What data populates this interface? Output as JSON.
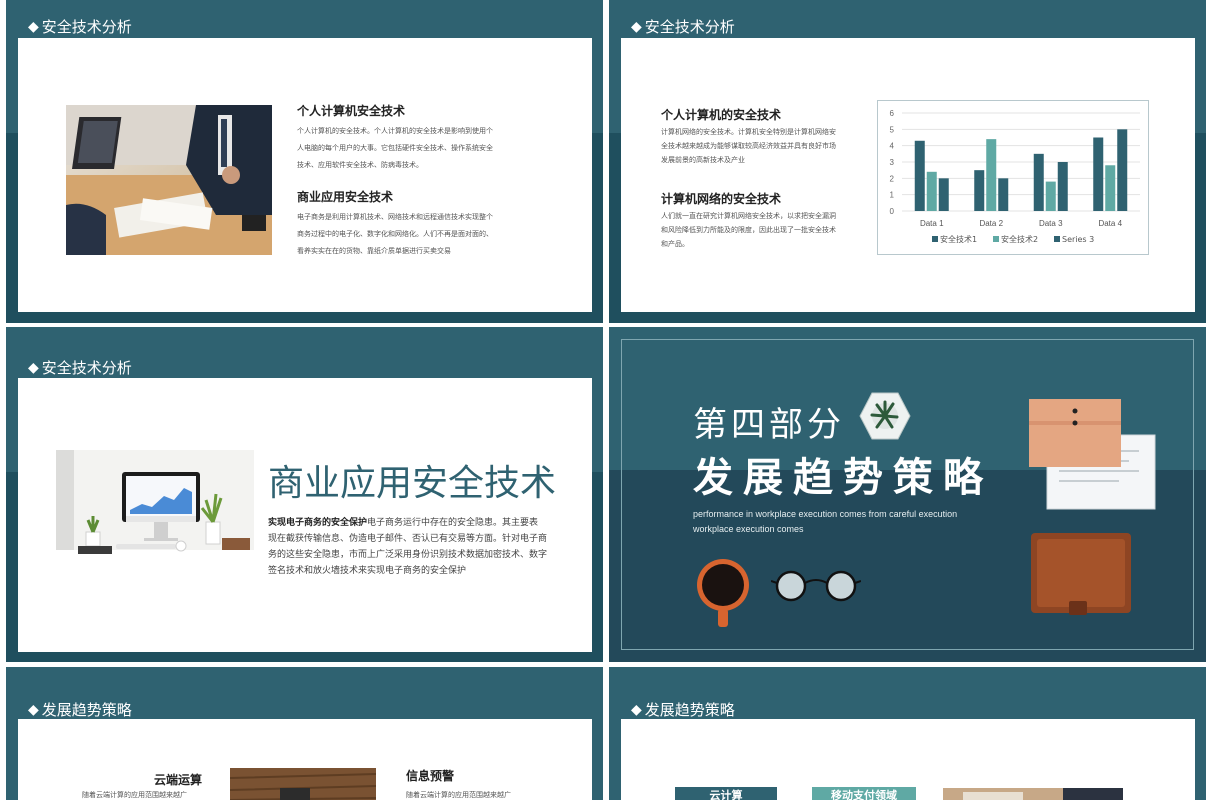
{
  "common": {
    "diamond": "◆"
  },
  "slide1": {
    "header": "安全技术分析",
    "h1": "个人计算机安全技术",
    "p1": [
      "个人计算机的安全技术。个人计算机的安全技术是影响到使用个",
      "人电脑的每个用户的大事。它包括硬件安全技术、操作系统安全",
      "技术、应用软件安全技术、防病毒技术。"
    ],
    "h2": "商业应用安全技术",
    "p2": [
      "电子商务是利用计算机技术、网络技术和远程通信技术实现整个",
      "商务过程中的电子化、数字化和网络化。人们不再是面对面的、",
      "看养实实在在的货物、靠纸介质单据进行买卖交易"
    ]
  },
  "slide2": {
    "header": "安全技术分析",
    "h1": "个人计算机的安全技术",
    "p1": [
      "计算机网络的安全技术。计算机安全特别是计算机网络安",
      "全技术越来越成为能够谋取较高经济效益并具有良好市场",
      "发展前景的高新技术及产业"
    ],
    "h2": "计算机网络的安全技术",
    "p2": [
      "人们就一直在研究计算机网络安全技术，以求把安全漏洞",
      "和风险降低到力所能及的限度，因此出现了一批安全技术",
      "和产品。"
    ]
  },
  "chart_data": {
    "type": "bar",
    "categories": [
      "Data 1",
      "Data 2",
      "Data 3",
      "Data 4"
    ],
    "series": [
      {
        "name": "安全技术1",
        "values": [
          4.3,
          2.5,
          3.5,
          4.5
        ],
        "color": "#2f6271"
      },
      {
        "name": "安全技术2",
        "values": [
          2.4,
          4.4,
          1.8,
          2.8
        ],
        "color": "#5fa9a4"
      },
      {
        "name": "Series 3",
        "values": [
          2.0,
          2.0,
          3.0,
          5.0
        ],
        "color": "#2f6271"
      }
    ],
    "yticks": [
      "0",
      "1",
      "2",
      "3",
      "4",
      "5",
      "6"
    ],
    "ylim": [
      0,
      6
    ],
    "grid": true,
    "legend": "bottom"
  },
  "slide3": {
    "header": "安全技术分析",
    "title": "商业应用安全技术",
    "lead": "实现电子商务的安全保护",
    "body_first": "电子商务运行中存在的安全隐患。其主要表",
    "body": [
      "现在截获传输信息、伪造电子邮件、否认已有交易等方面。针对电子商",
      "务的这些安全隐患，市而上广泛采用身份识别技术数据加密技术、数字",
      "签名技术和放火墙技术来实现电子商务的安全保护"
    ]
  },
  "slide4": {
    "part": "第四部分",
    "title": "发展趋势策略",
    "en": [
      "performance in workplace execution comes from careful execution",
      "workplace execution comes"
    ]
  },
  "slide5": {
    "header": "发展趋势策略",
    "h1": "云端运算",
    "p1": "随着云端计算的应用范围越来越广",
    "h2": "信息预警",
    "p2": "随着云端计算的应用范围越来越广"
  },
  "slide6": {
    "header": "发展趋势策略",
    "pill1": "云计算",
    "pill2": "移动支付领域"
  }
}
